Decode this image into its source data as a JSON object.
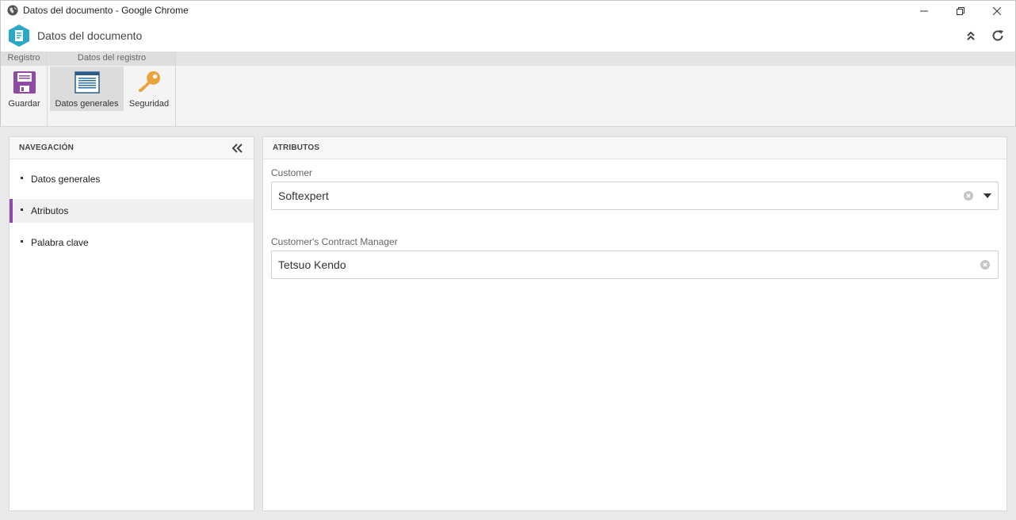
{
  "window": {
    "title": "Datos del documento - Google Chrome"
  },
  "header": {
    "title": "Datos del documento"
  },
  "ribbon": {
    "groups": [
      {
        "label": "Registro"
      },
      {
        "label": "Datos del registro"
      }
    ],
    "buttons": {
      "save": "Guardar",
      "general": "Datos generales",
      "security": "Seguridad"
    }
  },
  "nav": {
    "heading": "NAVEGACIÓN",
    "items": [
      {
        "label": "Datos generales"
      },
      {
        "label": "Atributos"
      },
      {
        "label": "Palabra clave"
      }
    ],
    "selected": "Atributos"
  },
  "attributes": {
    "heading": "ATRIBUTOS",
    "fields": [
      {
        "label": "Customer",
        "value": "Softexpert"
      },
      {
        "label": "Customer's Contract Manager",
        "value": "Tetsuo Kendo"
      }
    ]
  },
  "colors": {
    "accent": "#8e4aa4",
    "logo": "#29a8c8",
    "key": "#e8a33a"
  }
}
